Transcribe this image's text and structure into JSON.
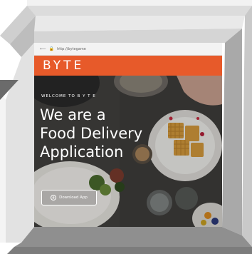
{
  "browser": {
    "url": "http://bytegame"
  },
  "navbar": {
    "brand": "BYTE",
    "brand_color": "#e75a2a"
  },
  "hero": {
    "welcome": "WELCOME TO B Y T E",
    "headline_line1": "We are a",
    "headline_line2": "Food Delivery",
    "headline_line3": "Application",
    "download_label": "Download App",
    "download_icon": "download-icon"
  }
}
